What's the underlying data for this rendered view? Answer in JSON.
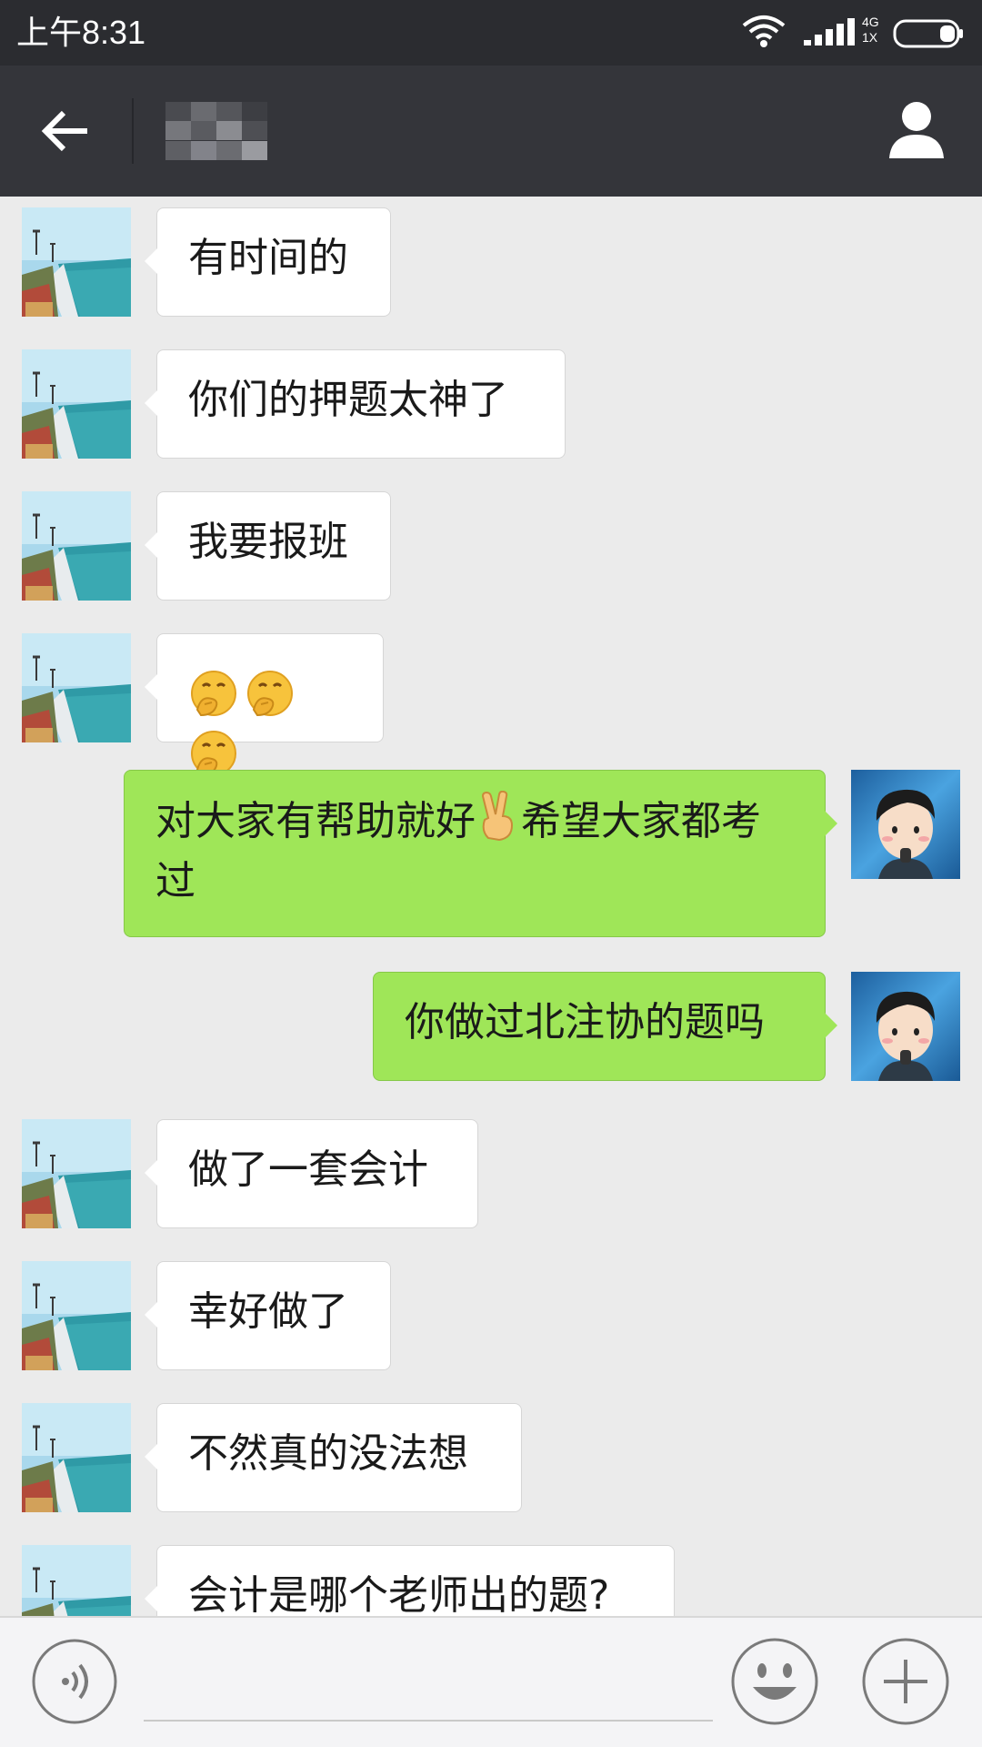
{
  "status_bar": {
    "time": "上午8:31",
    "network_top": "4G",
    "network_bottom": "1X",
    "icons": [
      "wifi-icon",
      "signal-icon",
      "battery-icon"
    ]
  },
  "header": {
    "contact_name": "",
    "icons": [
      "back-arrow-icon",
      "person-icon"
    ]
  },
  "messages": [
    {
      "side": "in",
      "text": "有时间的"
    },
    {
      "side": "in",
      "text": "你们的押题太神了"
    },
    {
      "side": "in",
      "text": "我要报班"
    },
    {
      "side": "in",
      "emoji": "covering-mouth-face",
      "count": 3
    },
    {
      "side": "out",
      "text_before": "对大家有帮助就好",
      "emoji": "victory-hand",
      "text_after": "希望大家都考过"
    },
    {
      "side": "out",
      "text": "你做过北注协的题吗"
    },
    {
      "side": "in",
      "text": "做了一套会计"
    },
    {
      "side": "in",
      "text": "幸好做了"
    },
    {
      "side": "in",
      "text": "不然真的没法想"
    },
    {
      "side": "in",
      "text": "会计是哪个老师出的题?"
    }
  ],
  "input_bar": {
    "placeholder": "",
    "icons": [
      "voice-icon",
      "emoji-icon",
      "plus-icon"
    ]
  },
  "colors": {
    "status_bar_bg": "#2b2c30",
    "header_bg": "#34353a",
    "chat_bg": "#ebebeb",
    "outgoing_bubble": "#9fe658",
    "incoming_bubble": "#ffffff"
  }
}
